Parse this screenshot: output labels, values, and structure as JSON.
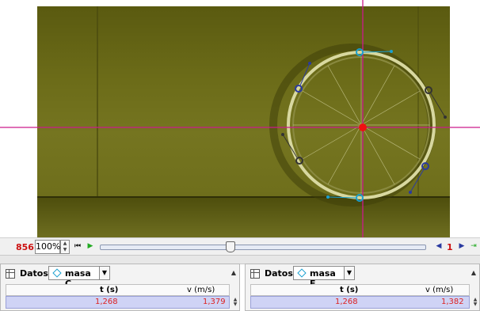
{
  "player": {
    "frame_number": "856",
    "zoom": "100%",
    "step_number": "1",
    "slider_position": 0.4
  },
  "tables": [
    {
      "title": "Datos",
      "mass": "masa C",
      "col_t": "t (s)",
      "col_v": "v (m/s)",
      "t_value": "1,268",
      "v_value": "1,379"
    },
    {
      "title": "Datos",
      "mass": "masa F",
      "col_t": "t (s)",
      "col_v": "v (m/s)",
      "t_value": "1,268",
      "v_value": "1,382"
    }
  ],
  "icons": [
    "table-icon",
    "diamond-icon",
    "dropdown-arrow-icon",
    "step-back-icon",
    "play-icon",
    "step-forward-icon",
    "prev-step-icon",
    "next-step-icon"
  ],
  "colors": {
    "crosshair": "#cc1a8c",
    "accent_red": "#cc1111",
    "mass_cyan": "#1aa0d0",
    "mass_blue": "#2a3aa0",
    "mass_dark": "#333333"
  }
}
